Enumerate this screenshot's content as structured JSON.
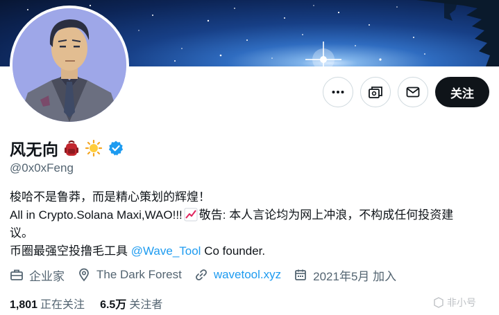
{
  "profile": {
    "display_name": "风无向",
    "handle": "@0x0xFeng"
  },
  "actions": {
    "follow_label": "关注"
  },
  "bio": {
    "line1": "梭哈不是鲁莽，而是精心策划的辉煌！",
    "line2_text": "All in Crypto.Solana Maxi,WAO!!!",
    "line2_after": "敬告: 本人言论均为网上冲浪，不构成任何投资建",
    "line3": "议。",
    "line4_before": "币圈最强空投撸毛工具 ",
    "line4_mention": "@Wave_Tool",
    "line4_after": " Co founder."
  },
  "meta": {
    "profession": "企业家",
    "location": "The Dark Forest",
    "website": "wavetool.xyz",
    "joined": "2021年5月 加入"
  },
  "stats": {
    "following_count": "1,801",
    "following_label": "正在关注",
    "followers_count": "6.5万",
    "followers_label": "关注者"
  },
  "watermark": {
    "text": "非小号"
  },
  "colors": {
    "link": "#1d9bf0",
    "verified": "#1d9bf0",
    "follow_button": "#0f1419",
    "secondary_text": "#536471"
  },
  "icons": [
    "more-icon",
    "subscribe-icon",
    "message-icon",
    "backpack-emoji-icon",
    "sun-emoji-icon",
    "verified-badge-icon",
    "chart-emoji-icon",
    "briefcase-icon",
    "location-pin-icon",
    "link-icon",
    "calendar-icon"
  ]
}
